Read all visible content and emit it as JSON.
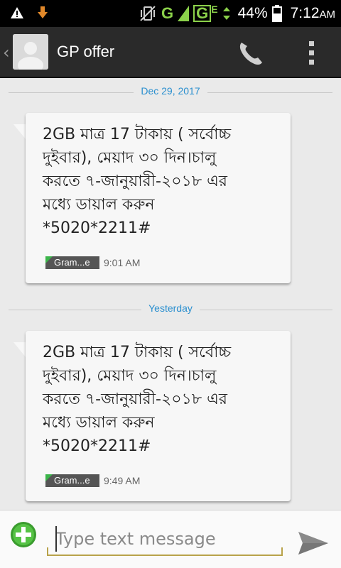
{
  "status_bar": {
    "network_letter_1": "G",
    "network_letter_2": "G",
    "network_letter_3": "E",
    "battery_percent": "44%",
    "time": "7:12",
    "ampm": "AM",
    "accent_color": "#8bd14a"
  },
  "header": {
    "back_glyph": "‹",
    "title": "GP offer"
  },
  "conversation": {
    "messages": [
      {
        "date_label": "Dec 29, 2017",
        "text_lines": [
          "2GB মাত্র 17 টাকায় ( সর্বোচ্চ",
          "দুইবার), মেয়াদ ৩০ দিন।চালু",
          "করতে ৭-জানুয়ারী-২০১৮ এর",
          "মধ্যে ডায়াল করুন",
          "*5020*2211#"
        ],
        "sender": "Gram...e",
        "time": "9:01 AM"
      },
      {
        "date_label": "Yesterday",
        "text_lines": [
          "2GB মাত্র 17 টাকায় ( সর্বোচ্চ",
          "দুইবার), মেয়াদ ৩০ দিন।চালু",
          "করতে ৭-জানুয়ারী-২০১৮ এর",
          "মধ্যে ডায়াল করুন",
          "*5020*2211#"
        ],
        "sender": "Gram...e",
        "time": "9:49 AM"
      }
    ]
  },
  "compose": {
    "placeholder": "Type text message",
    "value": ""
  },
  "icons": {
    "warning": "warning-icon",
    "download": "download-icon",
    "vibrate": "vibrate-icon",
    "battery": "battery-icon",
    "call": "phone-icon",
    "menu": "overflow-menu-icon",
    "attach": "add-icon",
    "send": "send-icon"
  }
}
